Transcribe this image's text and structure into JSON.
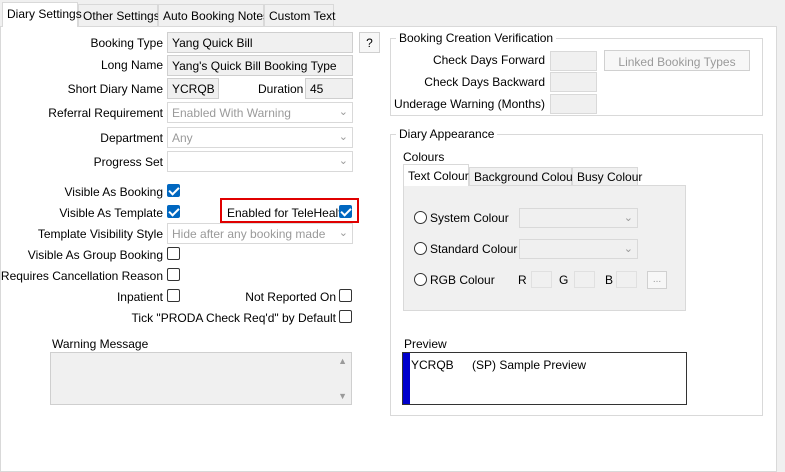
{
  "tabs": [
    "Diary Settings",
    "Other Settings",
    "Auto Booking Notes",
    "Custom Text"
  ],
  "booking_type": {
    "label": "Booking Type",
    "value": "Yang Quick Bill",
    "help": "?"
  },
  "long_name": {
    "label": "Long Name",
    "value": "Yang's Quick Bill Booking Type"
  },
  "short_diary_name": {
    "label": "Short Diary Name",
    "value": "YCRQB"
  },
  "duration": {
    "label": "Duration",
    "value": "45"
  },
  "referral_requirement": {
    "label": "Referral Requirement",
    "value": "Enabled With Warning"
  },
  "department": {
    "label": "Department",
    "value": "Any"
  },
  "progress_set": {
    "label": "Progress Set",
    "value": ""
  },
  "checkboxes": {
    "visible_as_booking": {
      "label": "Visible As Booking",
      "checked": true
    },
    "visible_as_template": {
      "label": "Visible As Template",
      "checked": true
    },
    "enabled_for_telehealth": {
      "label": "Enabled for TeleHealth",
      "checked": true
    },
    "visible_as_group_booking": {
      "label": "Visible As Group Booking",
      "checked": false
    },
    "requires_cancellation_reason": {
      "label": "Requires Cancellation Reason",
      "checked": false
    },
    "inpatient": {
      "label": "Inpatient",
      "checked": false
    },
    "not_reported_on": {
      "label": "Not Reported On",
      "checked": false
    },
    "proda_check": {
      "label": "Tick \"PRODA Check Req'd\" by Default",
      "checked": false
    }
  },
  "template_visibility_style": {
    "label": "Template Visibility Style",
    "value": "Hide after any booking made"
  },
  "warning_message": {
    "label": "Warning Message",
    "value": ""
  },
  "verification": {
    "title": "Booking Creation Verification",
    "check_days_forward": "Check Days Forward",
    "check_days_backward": "Check Days Backward",
    "underage_warning": "Underage Warning (Months)",
    "linked_button": "Linked Booking Types"
  },
  "appearance": {
    "title": "Diary Appearance",
    "colours_label": "Colours",
    "colour_tabs": [
      "Text Colour",
      "Background Colour",
      "Busy Colour"
    ],
    "system_colour": "System Colour",
    "standard_colour": "Standard Colour",
    "rgb_colour": "RGB Colour",
    "r": "R",
    "g": "G",
    "b": "B",
    "ellipsis": "...",
    "preview_label": "Preview",
    "preview_code": "YCRQB",
    "preview_text": "(SP) Sample Preview",
    "preview_bar_color": "#0000cc"
  },
  "highlight_color": "#e00000"
}
